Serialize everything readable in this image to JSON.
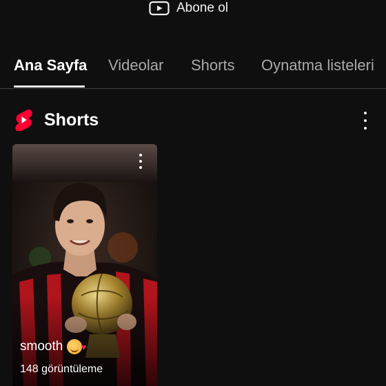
{
  "subscribe": {
    "label": "Abone ol",
    "icon": "youtube-play-icon"
  },
  "tabs": [
    {
      "label": "Ana Sayfa",
      "active": true
    },
    {
      "label": "Videolar",
      "active": false
    },
    {
      "label": "Shorts",
      "active": false
    },
    {
      "label": "Oynatma listeleri",
      "active": false
    }
  ],
  "section": {
    "title": "Shorts",
    "icon": "shorts-logo-icon",
    "menu_icon": "more-vert-icon"
  },
  "shorts": [
    {
      "title": "smooth",
      "emoji": "smiling-face-with-hearts",
      "views": "148 görüntüleme",
      "menu_icon": "more-vert-icon"
    }
  ],
  "colors": {
    "background": "#0f0f0f",
    "text": "#f1f1f1",
    "muted": "#aaaaaa",
    "shorts_red": "#ff0033",
    "jersey_red": "#b0141c"
  }
}
